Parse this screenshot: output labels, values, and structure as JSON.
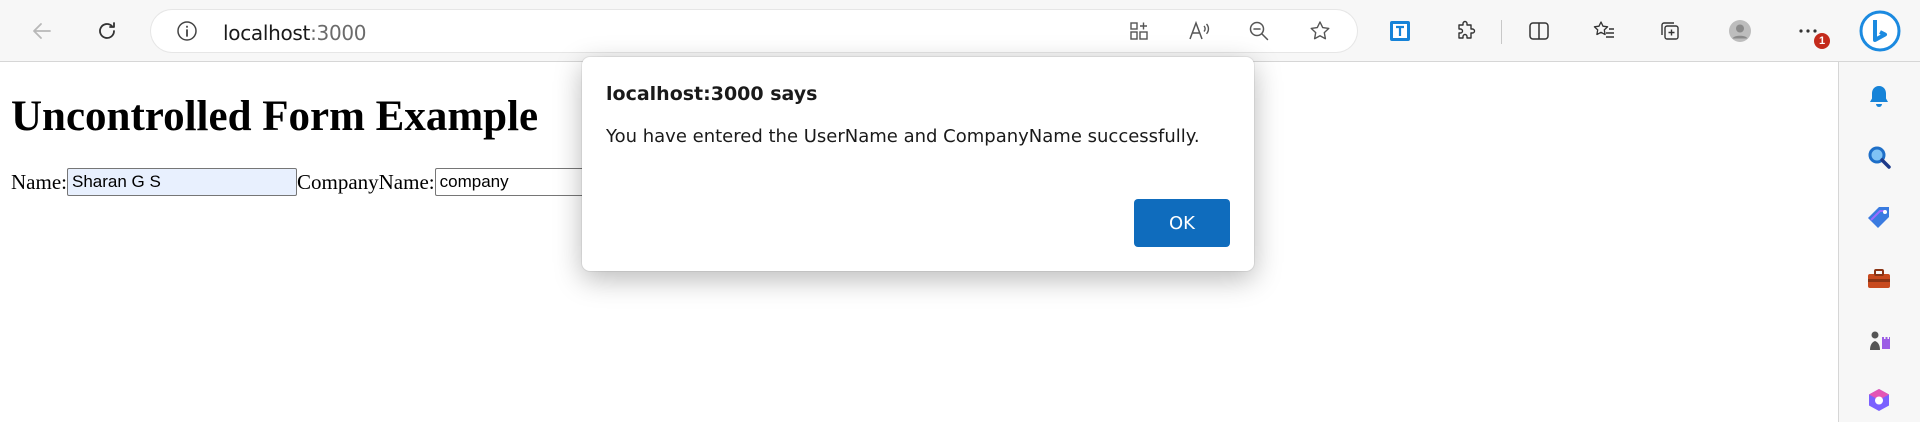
{
  "browser": {
    "url_host": "localhost",
    "url_port": ":3000",
    "notification_count": "1"
  },
  "page": {
    "title": "Uncontrolled Form Example",
    "form": {
      "name_label": "Name:",
      "name_value": "Sharan G S",
      "company_label": "CompanyName:",
      "company_value": "company"
    }
  },
  "alert": {
    "title": "localhost:3000 says",
    "message": "You have entered the UserName and CompanyName successfully.",
    "ok_label": "OK"
  },
  "colors": {
    "accent": "#0f6cbd",
    "autofill": "#e8f0fe",
    "badge": "#c42b1c"
  },
  "icons": {
    "toolbar": [
      "back-arrow-icon",
      "refresh-icon",
      "info-icon",
      "app-available-icon",
      "read-aloud-icon",
      "zoom-out-icon",
      "favorite-star-icon",
      "translator-extension-icon",
      "extensions-icon",
      "split-screen-icon",
      "favorites-icon",
      "collections-icon",
      "profile-icon",
      "more-menu-icon",
      "bing-copilot-icon"
    ],
    "sidebar": [
      "bell-icon",
      "search-icon",
      "shopping-tag-icon",
      "tools-briefcase-icon",
      "games-icon",
      "office-icon"
    ]
  }
}
